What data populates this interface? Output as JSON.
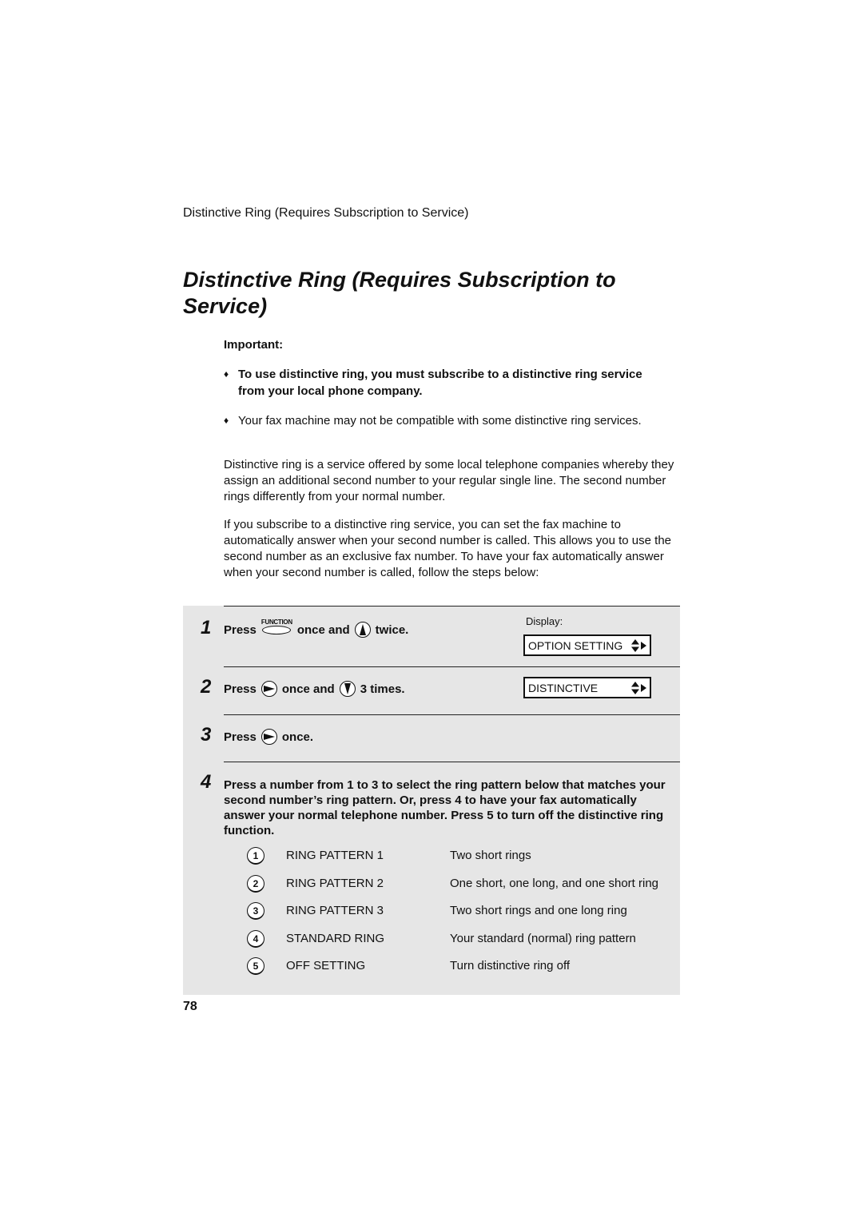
{
  "running_head": "Distinctive Ring (Requires Subscription to Service)",
  "title": "Distinctive Ring (Requires Subscription to Service)",
  "important": {
    "label": "Important:",
    "bullets": [
      {
        "text": "To use distinctive ring, you must subscribe to a distinctive ring service from your local phone company.",
        "bold": true
      },
      {
        "text": "Your fax machine may not be compatible with some distinctive ring services.",
        "bold": false
      }
    ],
    "bullet_glyph": "♦"
  },
  "paragraphs": [
    "Distinctive ring is a service offered by some local telephone companies whereby they assign an additional second number to your regular single line. The second number rings differently from your normal number.",
    "If you subscribe to a distinctive ring service, you can set the fax machine to automatically answer when your second number is called. This allows you to use the second number as an exclusive fax number. To have your fax automatically answer when your second number is called, follow the steps below:"
  ],
  "display_label": "Display:",
  "steps": [
    {
      "number": "1",
      "press": "Press",
      "key1_label": "FUNCTION",
      "mid": "once and",
      "key2": "up-arrow",
      "end": "twice.",
      "display": "OPTION SETTING"
    },
    {
      "number": "2",
      "press": "Press",
      "key1": "right-arrow",
      "mid": "once and",
      "key2": "down-arrow",
      "end": "3 times.",
      "display": "DISTINCTIVE"
    },
    {
      "number": "3",
      "press": "Press",
      "key1": "right-arrow",
      "end": "once."
    },
    {
      "number": "4",
      "text": "Press a number from 1 to 3 to select the ring pattern below that matches your second number’s ring pattern. Or, press 4 to have your fax automatically answer your normal telephone number. Press 5 to turn off the distinctive ring function."
    }
  ],
  "options": [
    {
      "key": "1",
      "name": "RING PATTERN 1",
      "desc": "Two short rings"
    },
    {
      "key": "2",
      "name": "RING PATTERN 2",
      "desc": "One short, one long, and one short ring"
    },
    {
      "key": "3",
      "name": "RING PATTERN 3",
      "desc": "Two short rings and one long ring"
    },
    {
      "key": "4",
      "name": "STANDARD RING",
      "desc": "Your standard (normal) ring pattern"
    },
    {
      "key": "5",
      "name": "OFF SETTING",
      "desc": "Turn distinctive ring off"
    }
  ],
  "page_number": "78",
  "colors": {
    "step_box_bg": "#e6e6e6",
    "text": "#111111"
  }
}
